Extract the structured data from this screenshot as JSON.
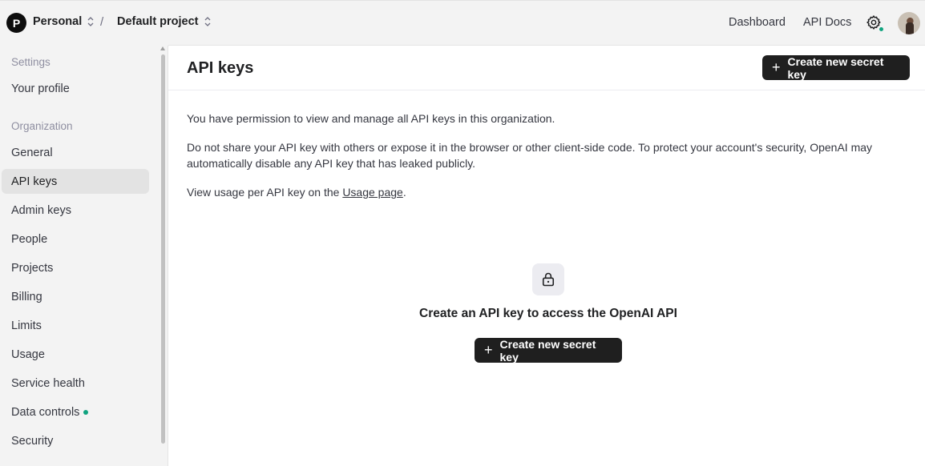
{
  "topbar": {
    "org_initial": "P",
    "org_name": "Personal",
    "separator": "/",
    "project_name": "Default project",
    "links": {
      "dashboard": "Dashboard",
      "api_docs": "API Docs"
    },
    "icons": {
      "org_switch": "chevron-up-down-icon",
      "settings": "gear-icon"
    },
    "settings_status_color": "#10a37f"
  },
  "sidebar": {
    "settings_heading": "Settings",
    "profile": "Your profile",
    "organization_heading": "Organization",
    "items": [
      {
        "label": "General"
      },
      {
        "label": "API keys"
      },
      {
        "label": "Admin keys"
      },
      {
        "label": "People"
      },
      {
        "label": "Projects"
      },
      {
        "label": "Billing"
      },
      {
        "label": "Limits"
      },
      {
        "label": "Usage"
      },
      {
        "label": "Service health"
      },
      {
        "label": "Data controls"
      },
      {
        "label": "Security"
      }
    ],
    "active_item": "API keys"
  },
  "main": {
    "title": "API keys",
    "create_button": "Create new secret key",
    "permission_text": "You have permission to view and manage all API keys in this organization.",
    "warning_text": "Do not share your API key with others or expose it in the browser or other client-side code. To protect your account's security, OpenAI may automatically disable any API key that has leaked publicly.",
    "usage_prefix": "View usage per API key on the ",
    "usage_link": "Usage page",
    "usage_suffix": ".",
    "empty_state": {
      "icon": "lock-icon",
      "title": "Create an API key to access the OpenAI API",
      "button": "Create new secret key"
    }
  },
  "colors": {
    "primary_button": "#1f1f1f",
    "status_green": "#10a37f"
  }
}
